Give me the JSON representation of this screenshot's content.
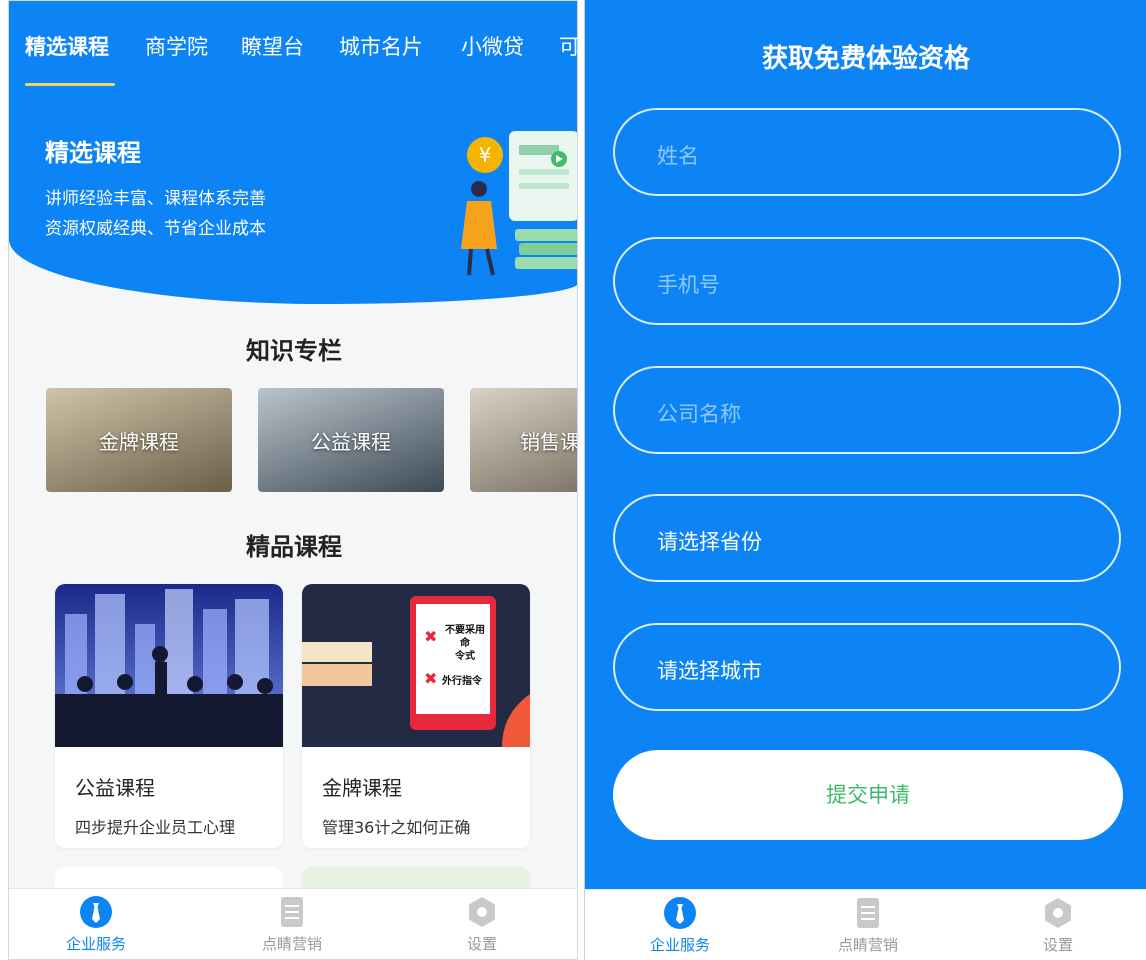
{
  "left": {
    "tabs": [
      "精选课程",
      "商学院",
      "瞭望台",
      "城市名片",
      "小微贷",
      "可"
    ],
    "hero": {
      "title": "精选课程",
      "line1": "讲师经验丰富、课程体系完善",
      "line2": "资源权威经典、节省企业成本"
    },
    "knowledge": {
      "title": "知识专栏",
      "items": [
        "金牌课程",
        "公益课程",
        "销售课"
      ]
    },
    "featured": {
      "title": "精品课程",
      "courses": [
        {
          "title": "公益课程",
          "desc": "四步提升企业员工心理"
        },
        {
          "title": "金牌课程",
          "desc": "管理36计之如何正确"
        }
      ],
      "image_text": {
        "line1": "不要采用命",
        "line2": "令式",
        "line3": "外行指令"
      }
    }
  },
  "right": {
    "title": "获取免费体验资格",
    "fields": {
      "name_placeholder": "姓名",
      "phone_placeholder": "手机号",
      "company_placeholder": "公司名称",
      "province": "请选择省份",
      "city": "请选择城市"
    },
    "submit_label": "提交申请"
  },
  "nav": {
    "items": [
      "企业服务",
      "点睛营销",
      "设置"
    ]
  },
  "colors": {
    "primary_blue": "#0c84f5",
    "submit_text_green": "#3dbb68",
    "tab_underline_yellow": "#f2d36a"
  },
  "icons": {
    "nav_service": "tie-icon",
    "nav_marketing": "document-icon",
    "nav_settings": "hexagon-gear-icon"
  }
}
